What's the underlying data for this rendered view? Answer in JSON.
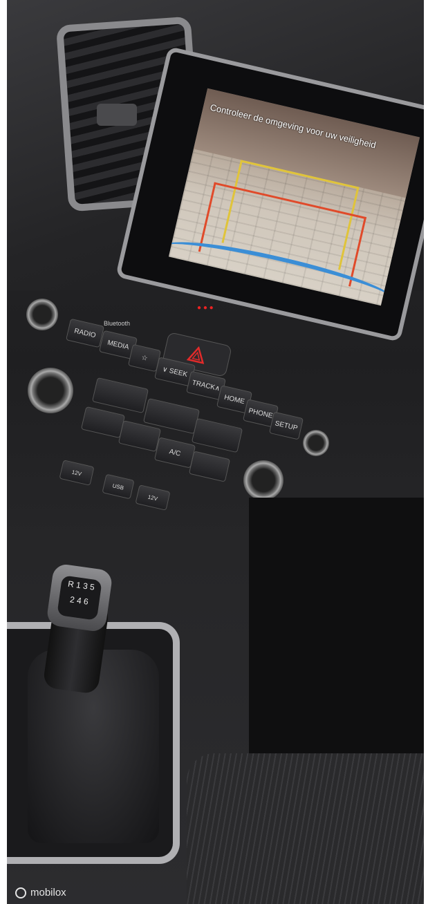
{
  "camera_screen": {
    "banner_text": "Controleer de omgeving voor uw veiligheid"
  },
  "buttons": {
    "radio": "RADIO",
    "media": "MEDIA",
    "star": "☆",
    "seek": "∨ SEEK",
    "track": "TRACK∧",
    "home": "HOME",
    "phone": "PHONE",
    "setup": "SETUP",
    "ac": "A/C"
  },
  "labels": {
    "bluetooth": "Bluetooth",
    "port_12v_left": "12V",
    "port_usb": "USB",
    "port_12v_right": "12V"
  },
  "gear_pattern": {
    "top": "R 1 3 5",
    "bottom": "2 4 6"
  },
  "watermark": {
    "text": "mobilox"
  },
  "colors": {
    "guide_yellow": "#e0c43a",
    "guide_red": "#e04a2a",
    "bumper_blue": "#3b8ed6",
    "hazard_red": "#e22a2a"
  }
}
